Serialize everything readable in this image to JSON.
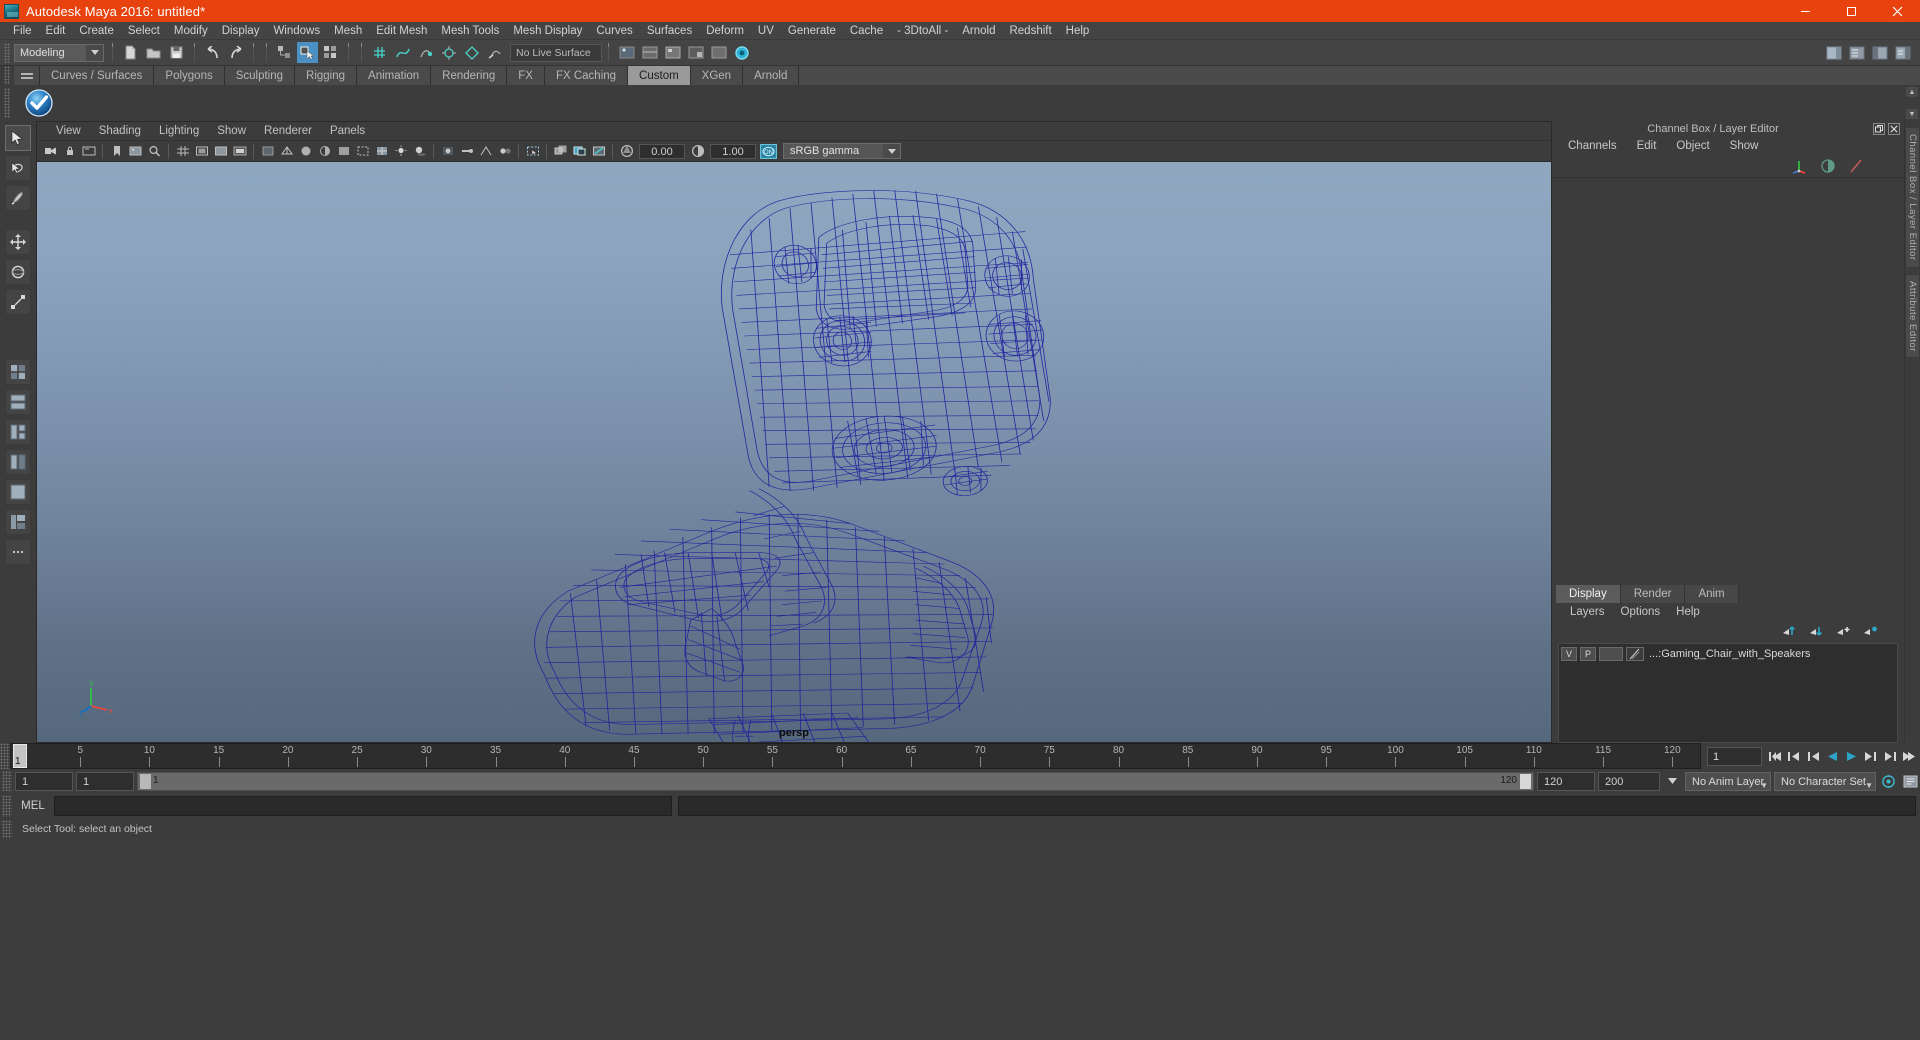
{
  "window": {
    "title": "Autodesk Maya 2016: untitled*",
    "app_icon": "maya-logo-icon",
    "controls": [
      {
        "name": "minimize-button",
        "glyph": "minimize-icon"
      },
      {
        "name": "maximize-button",
        "glyph": "maximize-icon"
      },
      {
        "name": "close-button",
        "glyph": "close-icon"
      }
    ],
    "titlebar_color": "#e8430f"
  },
  "menubar": {
    "items": [
      "File",
      "Edit",
      "Create",
      "Select",
      "Modify",
      "Display",
      "Windows",
      "Mesh",
      "Edit Mesh",
      "Mesh Tools",
      "Mesh Display",
      "Curves",
      "Surfaces",
      "Deform",
      "UV",
      "Generate",
      "Cache",
      "- 3DtoAll -",
      "Arnold",
      "Redshift",
      "Help"
    ]
  },
  "statusbar": {
    "mode": "Modeling",
    "live_surface": "No Live Surface",
    "icons": [
      "new-scene-icon",
      "open-scene-icon",
      "save-scene-icon",
      "undo-icon",
      "redo-icon",
      "select-hierarchy-icon",
      "select-object-icon",
      "select-component-icon",
      "snap-grid-icon",
      "snap-curve-icon",
      "snap-point-icon",
      "snap-projected-center-icon",
      "snap-view-plane-icon",
      "make-live-icon"
    ],
    "right_icons": [
      "show-hide-attribute-editor-icon",
      "show-hide-tool-settings-icon",
      "show-hide-channel-box-icon",
      "show-hide-modeling-toolkit-icon"
    ]
  },
  "shelf": {
    "tabs": [
      "Curves / Surfaces",
      "Polygons",
      "Sculpting",
      "Rigging",
      "Animation",
      "Rendering",
      "FX",
      "FX Caching",
      "Custom",
      "XGen",
      "Arnold"
    ],
    "active_tab": "Custom",
    "menu_icon": "shelf-menu-icon",
    "buttons": [
      "blue-check-shelf-icon"
    ],
    "scroll_up_icon": "chevron-up-icon",
    "scroll_down_icon": "chevron-down-icon"
  },
  "toolbox": {
    "items": [
      {
        "name": "select-tool",
        "icon": "arrow-cursor-icon",
        "selected": true
      },
      {
        "name": "lasso-tool",
        "icon": "lasso-cursor-icon",
        "selected": false
      },
      {
        "name": "paint-select-tool",
        "icon": "paint-brush-icon",
        "selected": false
      },
      {
        "name": "move-tool",
        "icon": "move-arrows-icon",
        "selected": false
      },
      {
        "name": "rotate-tool",
        "icon": "rotate-circle-icon",
        "selected": false
      },
      {
        "name": "scale-tool",
        "icon": "scale-box-icon",
        "selected": false
      },
      {
        "name": "last-tool",
        "icon": "last-tool-icon",
        "selected": false
      },
      {
        "name": "layout-single-pane",
        "icon": "single-pane-icon",
        "selected": false
      },
      {
        "name": "layout-two-pane-side",
        "icon": "two-pane-side-icon",
        "selected": false
      },
      {
        "name": "layout-two-pane-stacked",
        "icon": "two-pane-stacked-icon",
        "selected": false
      },
      {
        "name": "layout-three-pane",
        "icon": "three-pane-icon",
        "selected": false
      },
      {
        "name": "layout-four-pane",
        "icon": "four-pane-icon",
        "selected": false
      },
      {
        "name": "layout-outliner-persp",
        "icon": "outliner-persp-icon",
        "selected": false
      },
      {
        "name": "layout-hypershade",
        "icon": "hypershade-icon",
        "selected": false
      },
      {
        "name": "layout-more",
        "icon": "ellipsis-icon",
        "selected": false
      }
    ]
  },
  "viewport": {
    "menus": [
      "View",
      "Shading",
      "Lighting",
      "Show",
      "Renderer",
      "Panels"
    ],
    "toolbar": {
      "exposure_value": "0.00",
      "gamma_value": "1.00",
      "color_management_toggle": "ON",
      "color_profile": "sRGB gamma",
      "icons": [
        "select-camera-icon",
        "lock-camera-icon",
        "camera-attributes-icon",
        "bookmark-icon",
        "image-plane-icon",
        "two-d-pan-zoom-icon",
        "grid-toggle-icon",
        "film-gate-icon",
        "resolution-gate-icon",
        "gate-mask-icon",
        "film-origin-icon",
        "xray-icon",
        "xray-joints-icon",
        "xray-active-components-icon",
        "wireframe-icon",
        "smooth-shade-all-icon",
        "smooth-shade-selected-icon",
        "flat-shade-icon",
        "bounding-box-icon",
        "textured-icon",
        "lights-icon",
        "shadows-icon",
        "screen-space-ao-icon",
        "motion-blur-icon",
        "multisample-aa-icon",
        "depth-of-field-icon",
        "isolate-select-icon",
        "xray-mode-icon",
        "exposure-icon",
        "contrast-icon"
      ]
    },
    "camera_label": "persp",
    "axis_labels": {
      "x": "x",
      "y": "y",
      "z": "z"
    },
    "model_name": "Gaming_Chair_with_Speakers",
    "wireframe_color": "#1a1a9e",
    "background_top": "#8fa8c0",
    "background_bottom": "#56687e"
  },
  "channel_box": {
    "panel_title": "Channel Box / Layer Editor",
    "menus": [
      "Channels",
      "Edit",
      "Object",
      "Show"
    ],
    "icons": [
      "transform-axis-icon",
      "half-circle-icon",
      "slash-icon"
    ],
    "undock_icon": "undock-icon",
    "close_icon": "close-icon",
    "contents": []
  },
  "layer_editor": {
    "tabs": [
      "Display",
      "Render",
      "Anim"
    ],
    "active_tab": "Display",
    "menus": [
      "Layers",
      "Options",
      "Help"
    ],
    "buttons": [
      "move-layer-up-icon",
      "move-layer-down-icon",
      "new-layer-icon",
      "new-layer-from-selected-icon"
    ],
    "layers": [
      {
        "visibility": "V",
        "playback": "P",
        "type": "",
        "shading": "wire-icon",
        "name": "...:Gaming_Chair_with_Speakers"
      }
    ]
  },
  "side_tabs": [
    "Channel Box / Layer Editor",
    "Attribute Editor"
  ],
  "timeline": {
    "ticks": [
      5,
      10,
      15,
      20,
      25,
      30,
      35,
      40,
      45,
      50,
      55,
      60,
      65,
      70,
      75,
      80,
      85,
      90,
      95,
      100,
      105,
      110,
      115,
      120
    ],
    "current_frame": "1",
    "current_frame_field": "1",
    "start_field": "1",
    "end_field": "1",
    "range_start_label": "1",
    "range_end_label": "120",
    "range_end_field": "120",
    "playback_end_field": "200",
    "anim_layer": "No Anim Layer",
    "character_set": "No Character Set",
    "playback_buttons": [
      "go-to-start-icon",
      "step-back-frame-icon",
      "step-back-key-icon",
      "play-backwards-icon",
      "play-forwards-icon",
      "step-forward-key-icon",
      "step-forward-frame-icon",
      "go-to-end-icon"
    ],
    "right_icons": [
      "auto-key-icon",
      "animation-preferences-icon"
    ]
  },
  "command_line": {
    "language_label": "MEL",
    "input_value": "",
    "output_value": ""
  },
  "status_line": {
    "message": "Select Tool: select an object",
    "help_icon": "help-icon"
  }
}
